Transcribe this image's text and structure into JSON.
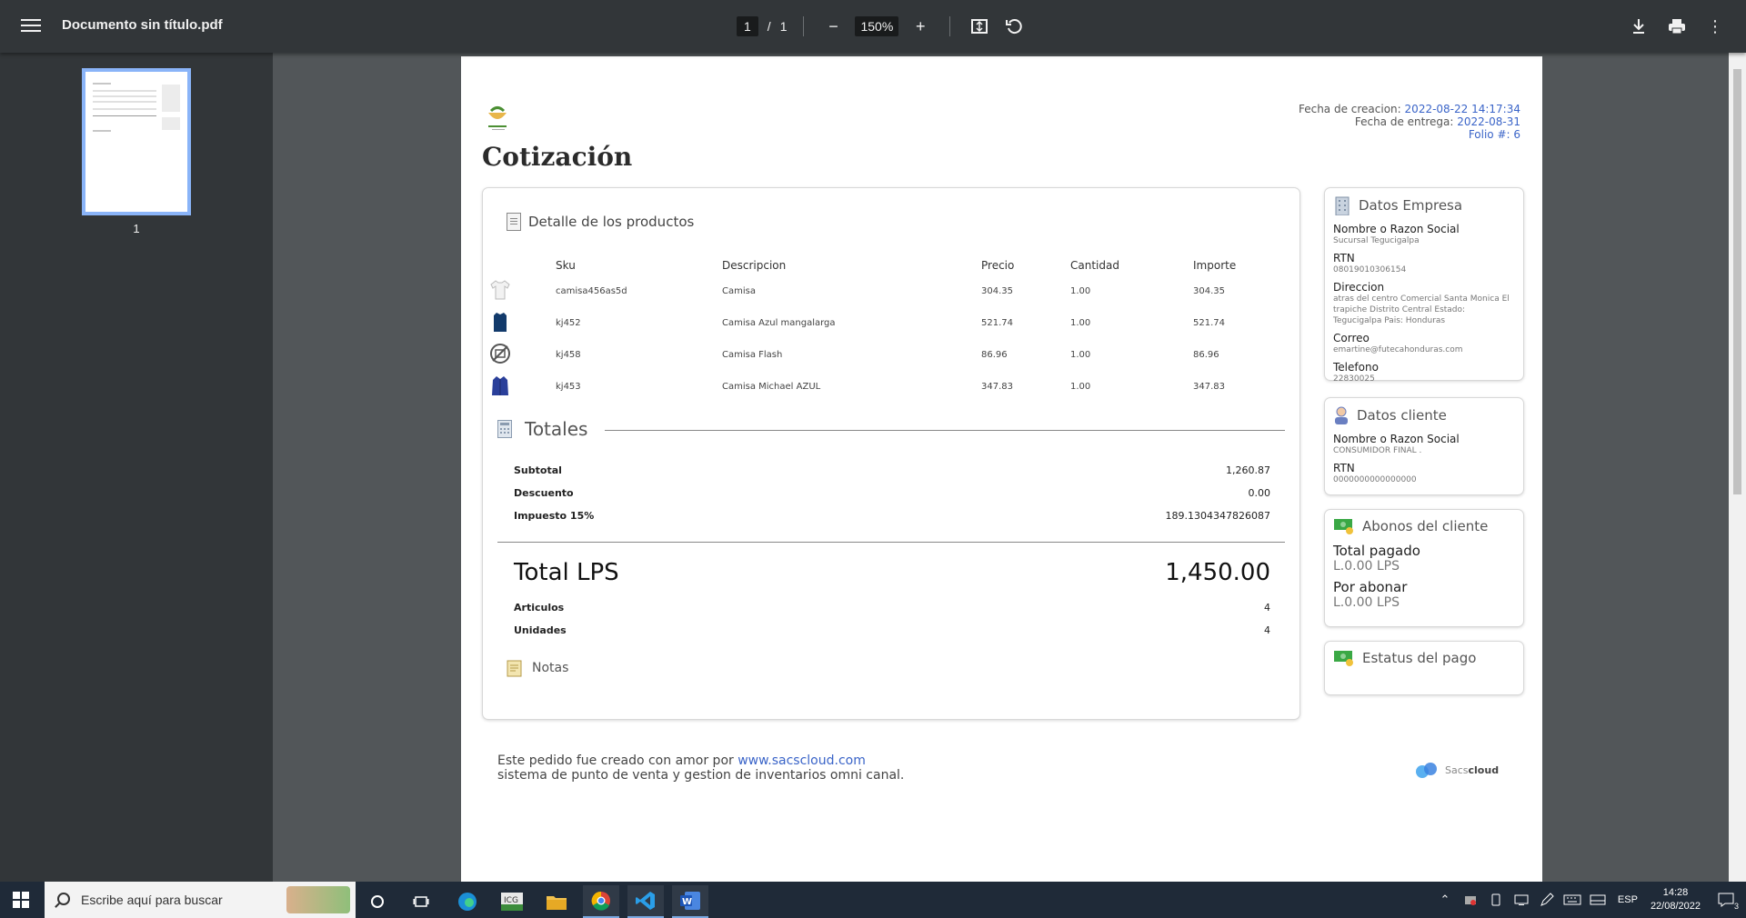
{
  "viewer": {
    "file_name": "Documento sin título.pdf",
    "current_page": "1",
    "page_separator": "/",
    "total_pages": "1",
    "zoom": "150%",
    "thumb_page_number": "1"
  },
  "document": {
    "title": "Cotización",
    "meta": {
      "created_label": "Fecha de creacion:",
      "created_value": "2022-08-22 14:17:34",
      "delivery_label": "Fecha de entrega:",
      "delivery_value": "2022-08-31",
      "folio": "Folio #: 6"
    },
    "products": {
      "heading": "Detalle de los productos",
      "columns": [
        "Sku",
        "Descripcion",
        "Precio",
        "Cantidad",
        "Importe"
      ],
      "rows": [
        {
          "sku": "camisa456as5d",
          "desc": "Camisa",
          "price": "304.35",
          "qty": "1.00",
          "amount": "304.35",
          "img": "white-shirt"
        },
        {
          "sku": "kj452",
          "desc": "Camisa Azul mangalarga",
          "price": "521.74",
          "qty": "1.00",
          "amount": "521.74",
          "img": "navy-shirt"
        },
        {
          "sku": "kj458",
          "desc": "Camisa Flash",
          "price": "86.96",
          "qty": "1.00",
          "amount": "86.96",
          "img": "no-image"
        },
        {
          "sku": "kj453",
          "desc": "Camisa Michael AZUL",
          "price": "347.83",
          "qty": "1.00",
          "amount": "347.83",
          "img": "blue-jacket"
        }
      ]
    },
    "totals": {
      "heading": "Totales",
      "subtotal_label": "Subtotal",
      "subtotal": "1,260.87",
      "discount_label": "Descuento",
      "discount": "0.00",
      "tax_label": "Impuesto 15%",
      "tax": "189.1304347826087",
      "total_label": "Total LPS",
      "total": "1,450.00",
      "articles_label": "Articulos",
      "articles": "4",
      "units_label": "Unidades",
      "units": "4"
    },
    "notes_heading": "Notas",
    "company": {
      "heading": "Datos Empresa",
      "name_label": "Nombre o Razon Social",
      "name": "Sucursal Tegucigalpa",
      "rtn_label": "RTN",
      "rtn": "08019010306154",
      "address_label": "Direccion",
      "address": "atras del centro Comercial Santa Monica El trapiche Distrito Central Estado: Tegucigalpa Pais: Honduras",
      "email_label": "Correo",
      "email": "emartine@futecahonduras.com",
      "phone_label": "Telefono",
      "phone": "22830025"
    },
    "client": {
      "heading": "Datos cliente",
      "name_label": "Nombre o Razon Social",
      "name": "CONSUMIDOR FINAL .",
      "rtn_label": "RTN",
      "rtn": "0000000000000000"
    },
    "payments": {
      "heading": "Abonos del cliente",
      "paid_label": "Total pagado",
      "paid": "L.0.00 LPS",
      "pending_label": "Por abonar",
      "pending": "L.0.00 LPS"
    },
    "status_heading": "Estatus del pago",
    "footer": {
      "line1_prefix": "Este pedido fue creado con amor por ",
      "link": "www.sacscloud.com",
      "line2": "sistema de punto de venta y gestion de inventarios omni canal.",
      "brand_a": "Sacs",
      "brand_b": "cloud"
    }
  },
  "taskbar": {
    "search_placeholder": "Escribe aquí para buscar",
    "language": "ESP",
    "time": "14:28",
    "date": "22/08/2022",
    "notifications": "3"
  },
  "colors": {
    "link": "#3a64c8",
    "toolbar": "#323639",
    "thumb_highlight": "#8ab4f8"
  }
}
